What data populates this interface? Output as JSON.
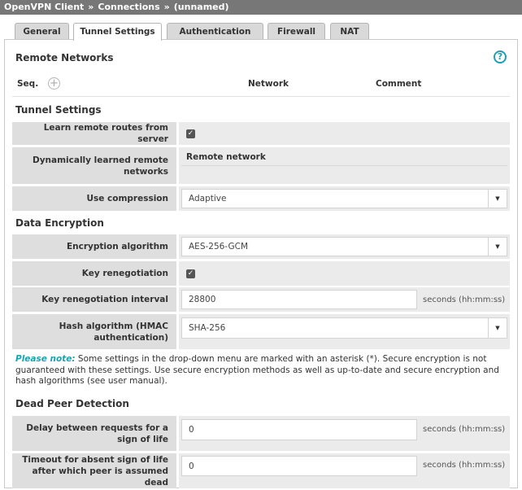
{
  "breadcrumb": {
    "items": [
      "OpenVPN Client",
      "Connections",
      "(unnamed)"
    ],
    "separator": "»"
  },
  "tabs": [
    "General",
    "Tunnel Settings",
    "Authentication",
    "Firewall",
    "NAT"
  ],
  "active_tab": "Tunnel Settings",
  "remote_networks": {
    "title": "Remote Networks",
    "help_icon": "question-circle-icon",
    "help_glyph": "?",
    "add_glyph": "+",
    "columns": {
      "seq": "Seq.",
      "network": "Network",
      "comment": "Comment"
    }
  },
  "tunnel_settings": {
    "title": "Tunnel Settings",
    "learn_routes": {
      "label": "Learn remote routes from server",
      "checked": true
    },
    "learned_networks": {
      "label": "Dynamically learned remote networks",
      "header": "Remote network"
    },
    "compression": {
      "label": "Use compression",
      "value": "Adaptive"
    }
  },
  "data_encryption": {
    "title": "Data Encryption",
    "algorithm": {
      "label": "Encryption algorithm",
      "value": "AES-256-GCM"
    },
    "key_reneg": {
      "label": "Key renegotiation",
      "checked": true
    },
    "key_reneg_interval": {
      "label": "Key renegotiation interval",
      "value": "28800",
      "unit": "seconds (hh:mm:ss)"
    },
    "hash": {
      "label": "Hash algorithm (HMAC authentication)",
      "value": "SHA-256"
    }
  },
  "note": {
    "label": "Please note:",
    "text": " Some settings in the drop-down menu are marked with an asterisk (*). Secure encryption is not guaranteed with these settings. Use secure encryption methods as well as up-to-date and secure encryption and hash algorithms (see user manual)."
  },
  "dpd": {
    "title": "Dead Peer Detection",
    "delay": {
      "label": "Delay between requests for a sign of life",
      "value": "0",
      "unit": "seconds (hh:mm:ss)"
    },
    "timeout": {
      "label": "Timeout for absent sign of life after which peer is assumed dead",
      "value": "0",
      "unit": "seconds (hh:mm:ss)"
    }
  },
  "glyphs": {
    "check": "✓",
    "caret": "▼"
  },
  "colors": {
    "accent": "#1ca0b5",
    "titlebar": "#777777",
    "label_bg": "#dedede",
    "value_bg": "#ebebeb"
  }
}
